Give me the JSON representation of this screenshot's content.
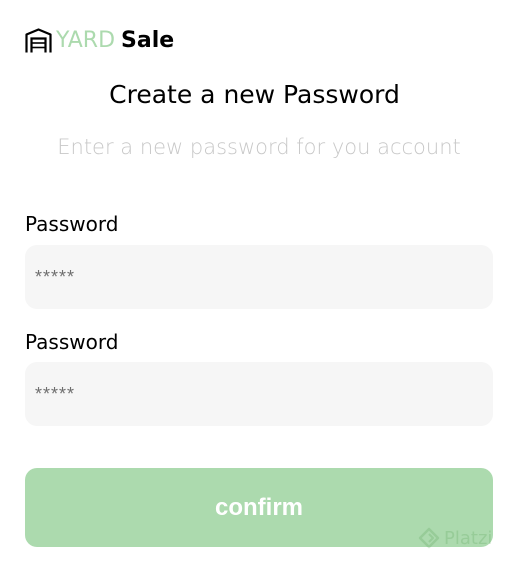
{
  "colors": {
    "brand_green": "#acdaae"
  },
  "logo": {
    "icon": "garage-icon",
    "yard": "YARD",
    "sale": "Sale"
  },
  "title": "Create a new Password",
  "subtitle": "Enter a new password for you account",
  "form": {
    "field1": {
      "label": "Password",
      "placeholder": "*****"
    },
    "field2": {
      "label": "Password",
      "placeholder": "*****"
    },
    "confirm_label": "confirm"
  },
  "watermark": {
    "icon": "platzi-icon",
    "text": "Platzi"
  }
}
